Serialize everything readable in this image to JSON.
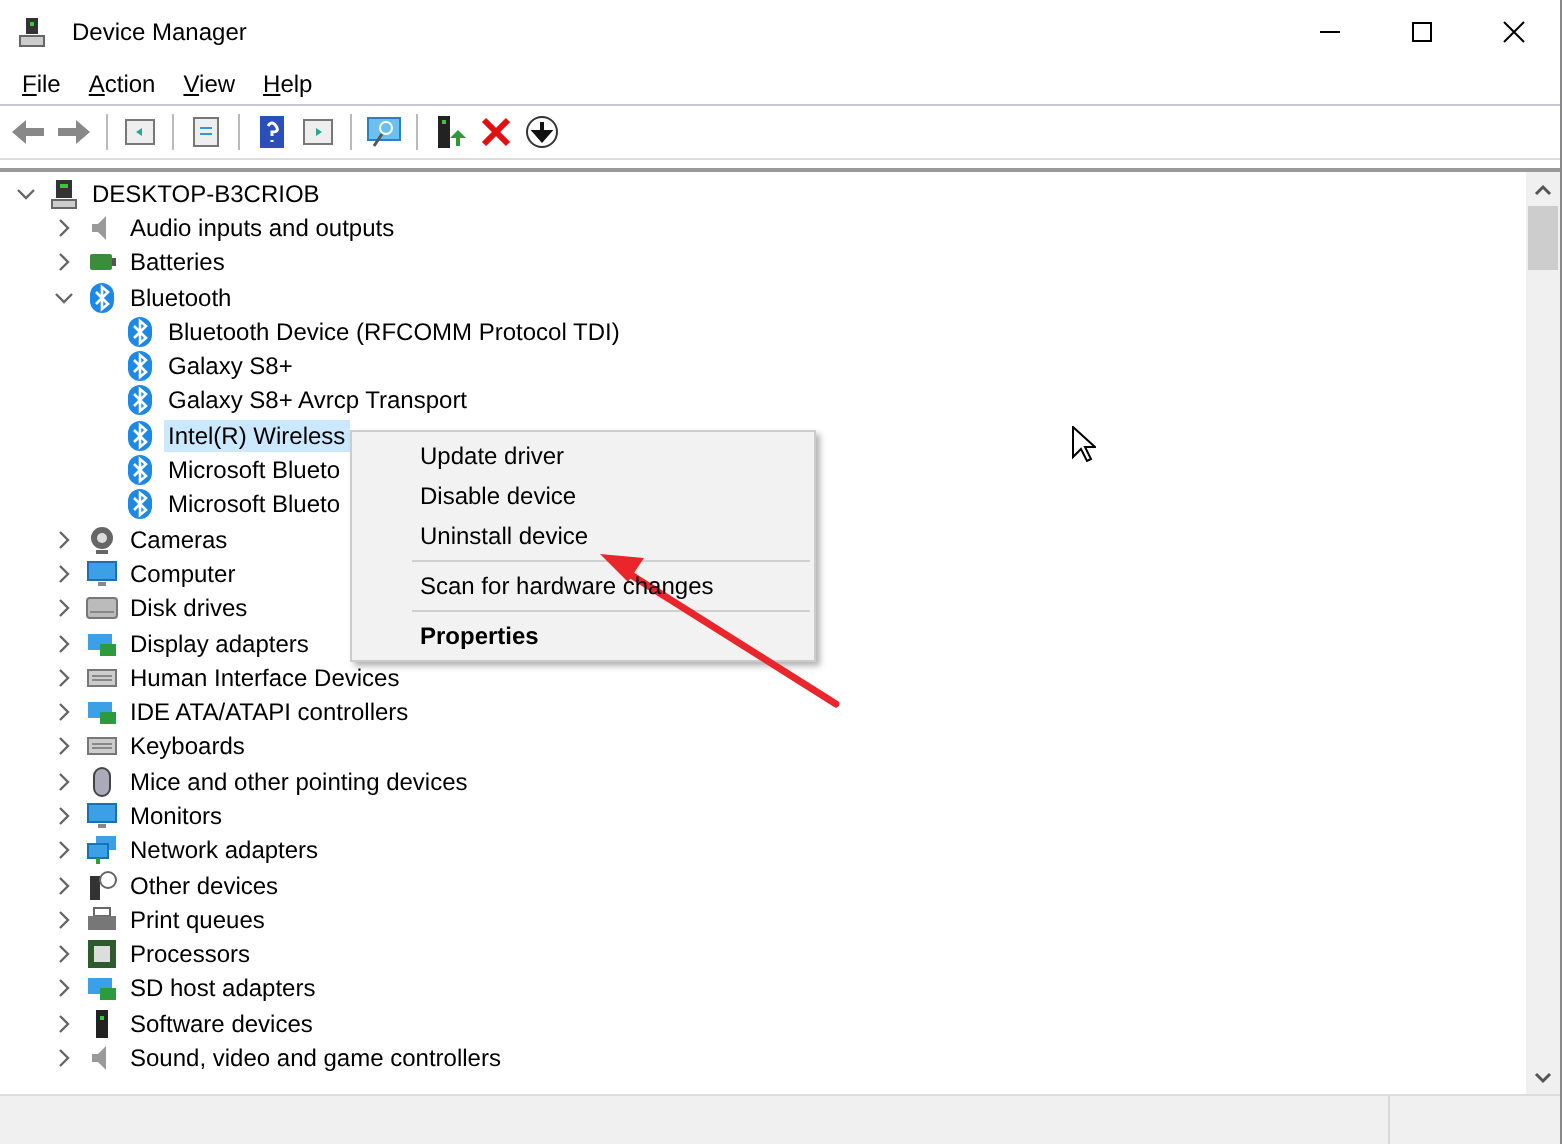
{
  "window": {
    "title": "Device Manager"
  },
  "menu_bar": [
    {
      "label": "File"
    },
    {
      "label": "Action"
    },
    {
      "label": "View"
    },
    {
      "label": "Help"
    }
  ],
  "tree": {
    "label": "DESKTOP-B3CRIOB",
    "expanded": true,
    "selected": false,
    "children": [
      {
        "label": "Audio inputs and outputs",
        "expanded": false,
        "selected": false
      },
      {
        "label": "Batteries",
        "expanded": false,
        "selected": false
      },
      {
        "label": "Bluetooth",
        "expanded": true,
        "selected": false,
        "children": [
          {
            "label": "Bluetooth Device (RFCOMM Protocol TDI)",
            "selected": false
          },
          {
            "label": "Galaxy S8+",
            "selected": false
          },
          {
            "label": "Galaxy S8+ Avrcp Transport",
            "selected": false
          },
          {
            "label": "Intel(R) Wireless",
            "selected": true
          },
          {
            "label": "Microsoft Blueto",
            "selected": false
          },
          {
            "label": "Microsoft Blueto",
            "selected": false
          }
        ]
      },
      {
        "label": "Cameras",
        "expanded": false,
        "selected": false
      },
      {
        "label": "Computer",
        "expanded": false,
        "selected": false
      },
      {
        "label": "Disk drives",
        "expanded": false,
        "selected": false
      },
      {
        "label": "Display adapters",
        "expanded": false,
        "selected": false
      },
      {
        "label": "Human Interface Devices",
        "expanded": false,
        "selected": false
      },
      {
        "label": "IDE ATA/ATAPI controllers",
        "expanded": false,
        "selected": false
      },
      {
        "label": "Keyboards",
        "expanded": false,
        "selected": false
      },
      {
        "label": "Mice and other pointing devices",
        "expanded": false,
        "selected": false
      },
      {
        "label": "Monitors",
        "expanded": false,
        "selected": false
      },
      {
        "label": "Network adapters",
        "expanded": false,
        "selected": false
      },
      {
        "label": "Other devices",
        "expanded": false,
        "selected": false
      },
      {
        "label": "Print queues",
        "expanded": false,
        "selected": false
      },
      {
        "label": "Processors",
        "expanded": false,
        "selected": false
      },
      {
        "label": "SD host adapters",
        "expanded": false,
        "selected": false
      },
      {
        "label": "Software devices",
        "expanded": false,
        "selected": false
      },
      {
        "label": "Sound, video and game controllers",
        "expanded": false,
        "selected": false
      }
    ]
  },
  "context_menu": [
    {
      "kind": "item",
      "label": "Update driver",
      "default": false
    },
    {
      "kind": "item",
      "label": "Disable device",
      "default": false
    },
    {
      "kind": "item",
      "label": "Uninstall device",
      "default": false
    },
    {
      "kind": "separator"
    },
    {
      "kind": "item",
      "label": "Scan for hardware changes",
      "default": false
    },
    {
      "kind": "separator"
    },
    {
      "kind": "item",
      "label": "Properties",
      "default": true
    }
  ]
}
